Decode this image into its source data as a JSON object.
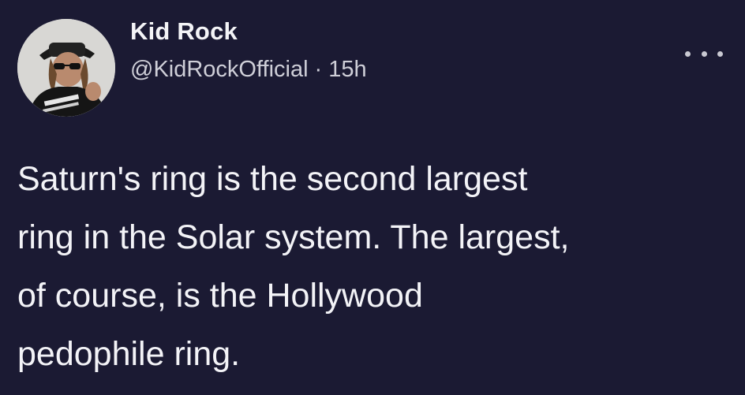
{
  "tweet": {
    "author": {
      "display_name": "Kid Rock",
      "handle": "@KidRockOfficial",
      "time_separator": "·",
      "timestamp": "15h",
      "avatar_icon": "profile-photo"
    },
    "more_icon": "more-horizontal-icon",
    "text_lines": [
      "Saturn's ring is the second largest",
      "ring in the Solar system. The largest,",
      "of course, is the Hollywood",
      "pedophile ring."
    ]
  },
  "colors": {
    "background": "#1b1a33",
    "primary_text": "#f3f3f7",
    "secondary_text": "#cfcfd8"
  }
}
